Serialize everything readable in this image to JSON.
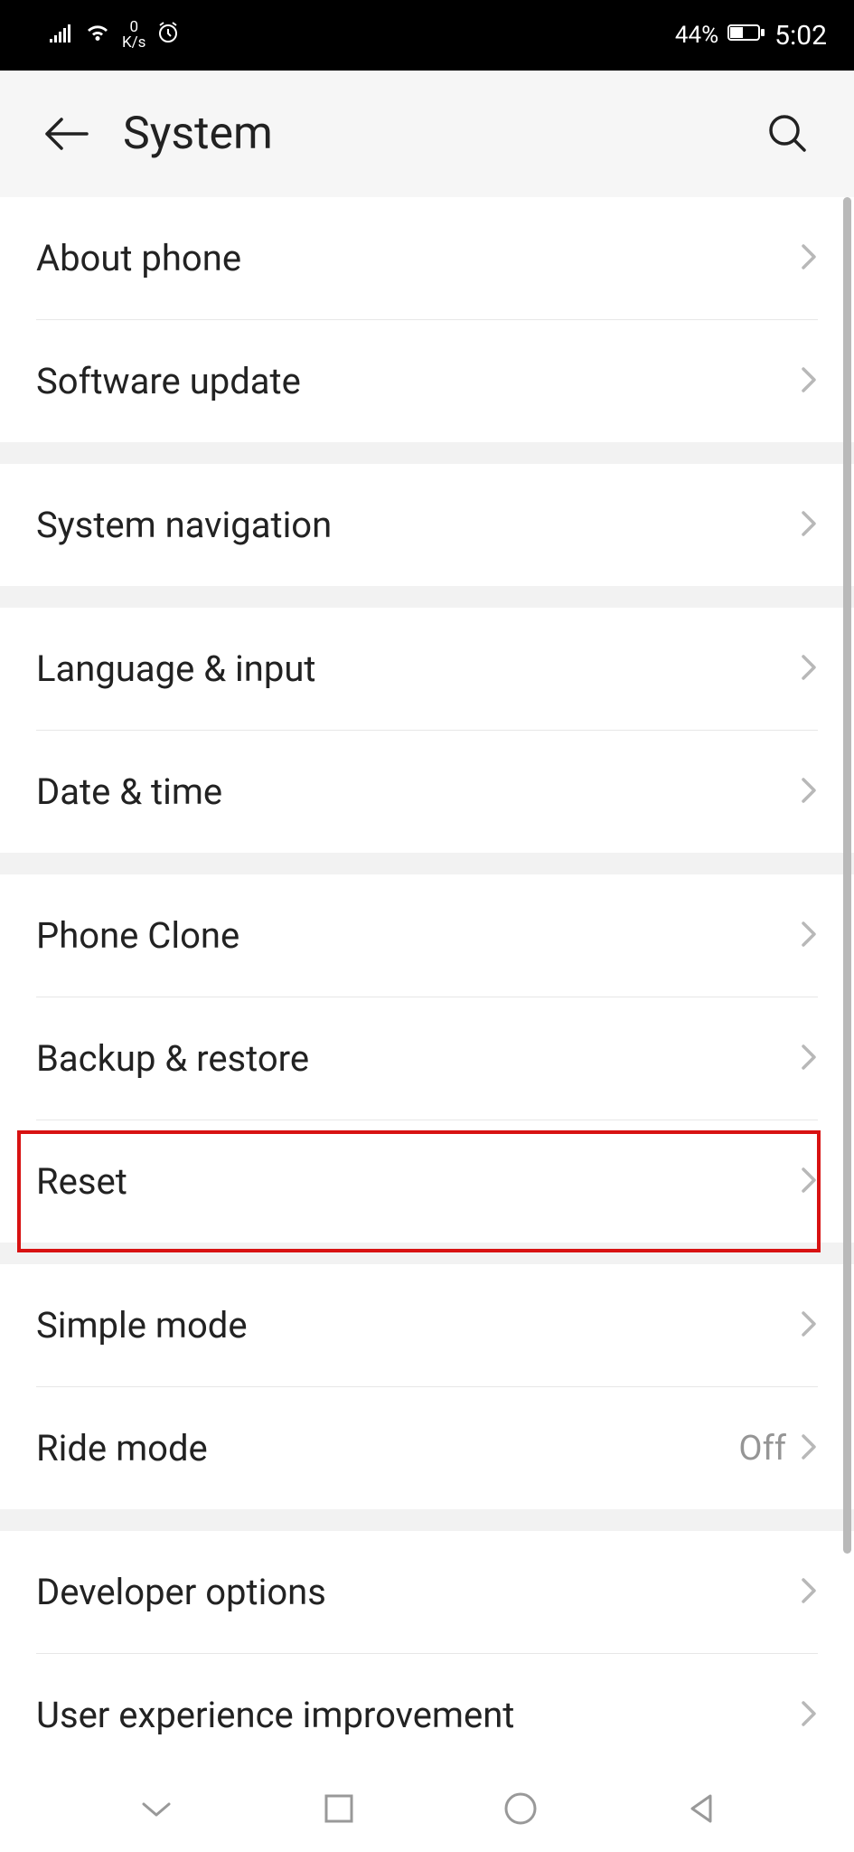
{
  "status": {
    "speed_top": "0",
    "speed_bottom": "K/s",
    "battery_pct": "44%",
    "time": "5:02"
  },
  "header": {
    "title": "System"
  },
  "groups": [
    {
      "items": [
        {
          "label": "About phone"
        },
        {
          "label": "Software update"
        }
      ]
    },
    {
      "items": [
        {
          "label": "System navigation"
        }
      ]
    },
    {
      "items": [
        {
          "label": "Language & input"
        },
        {
          "label": "Date & time"
        }
      ]
    },
    {
      "items": [
        {
          "label": "Phone Clone"
        },
        {
          "label": "Backup & restore"
        },
        {
          "label": "Reset"
        }
      ]
    },
    {
      "items": [
        {
          "label": "Simple mode"
        },
        {
          "label": "Ride mode",
          "value": "Off"
        }
      ]
    },
    {
      "items": [
        {
          "label": "Developer options"
        },
        {
          "label": "User experience improvement"
        }
      ]
    }
  ]
}
